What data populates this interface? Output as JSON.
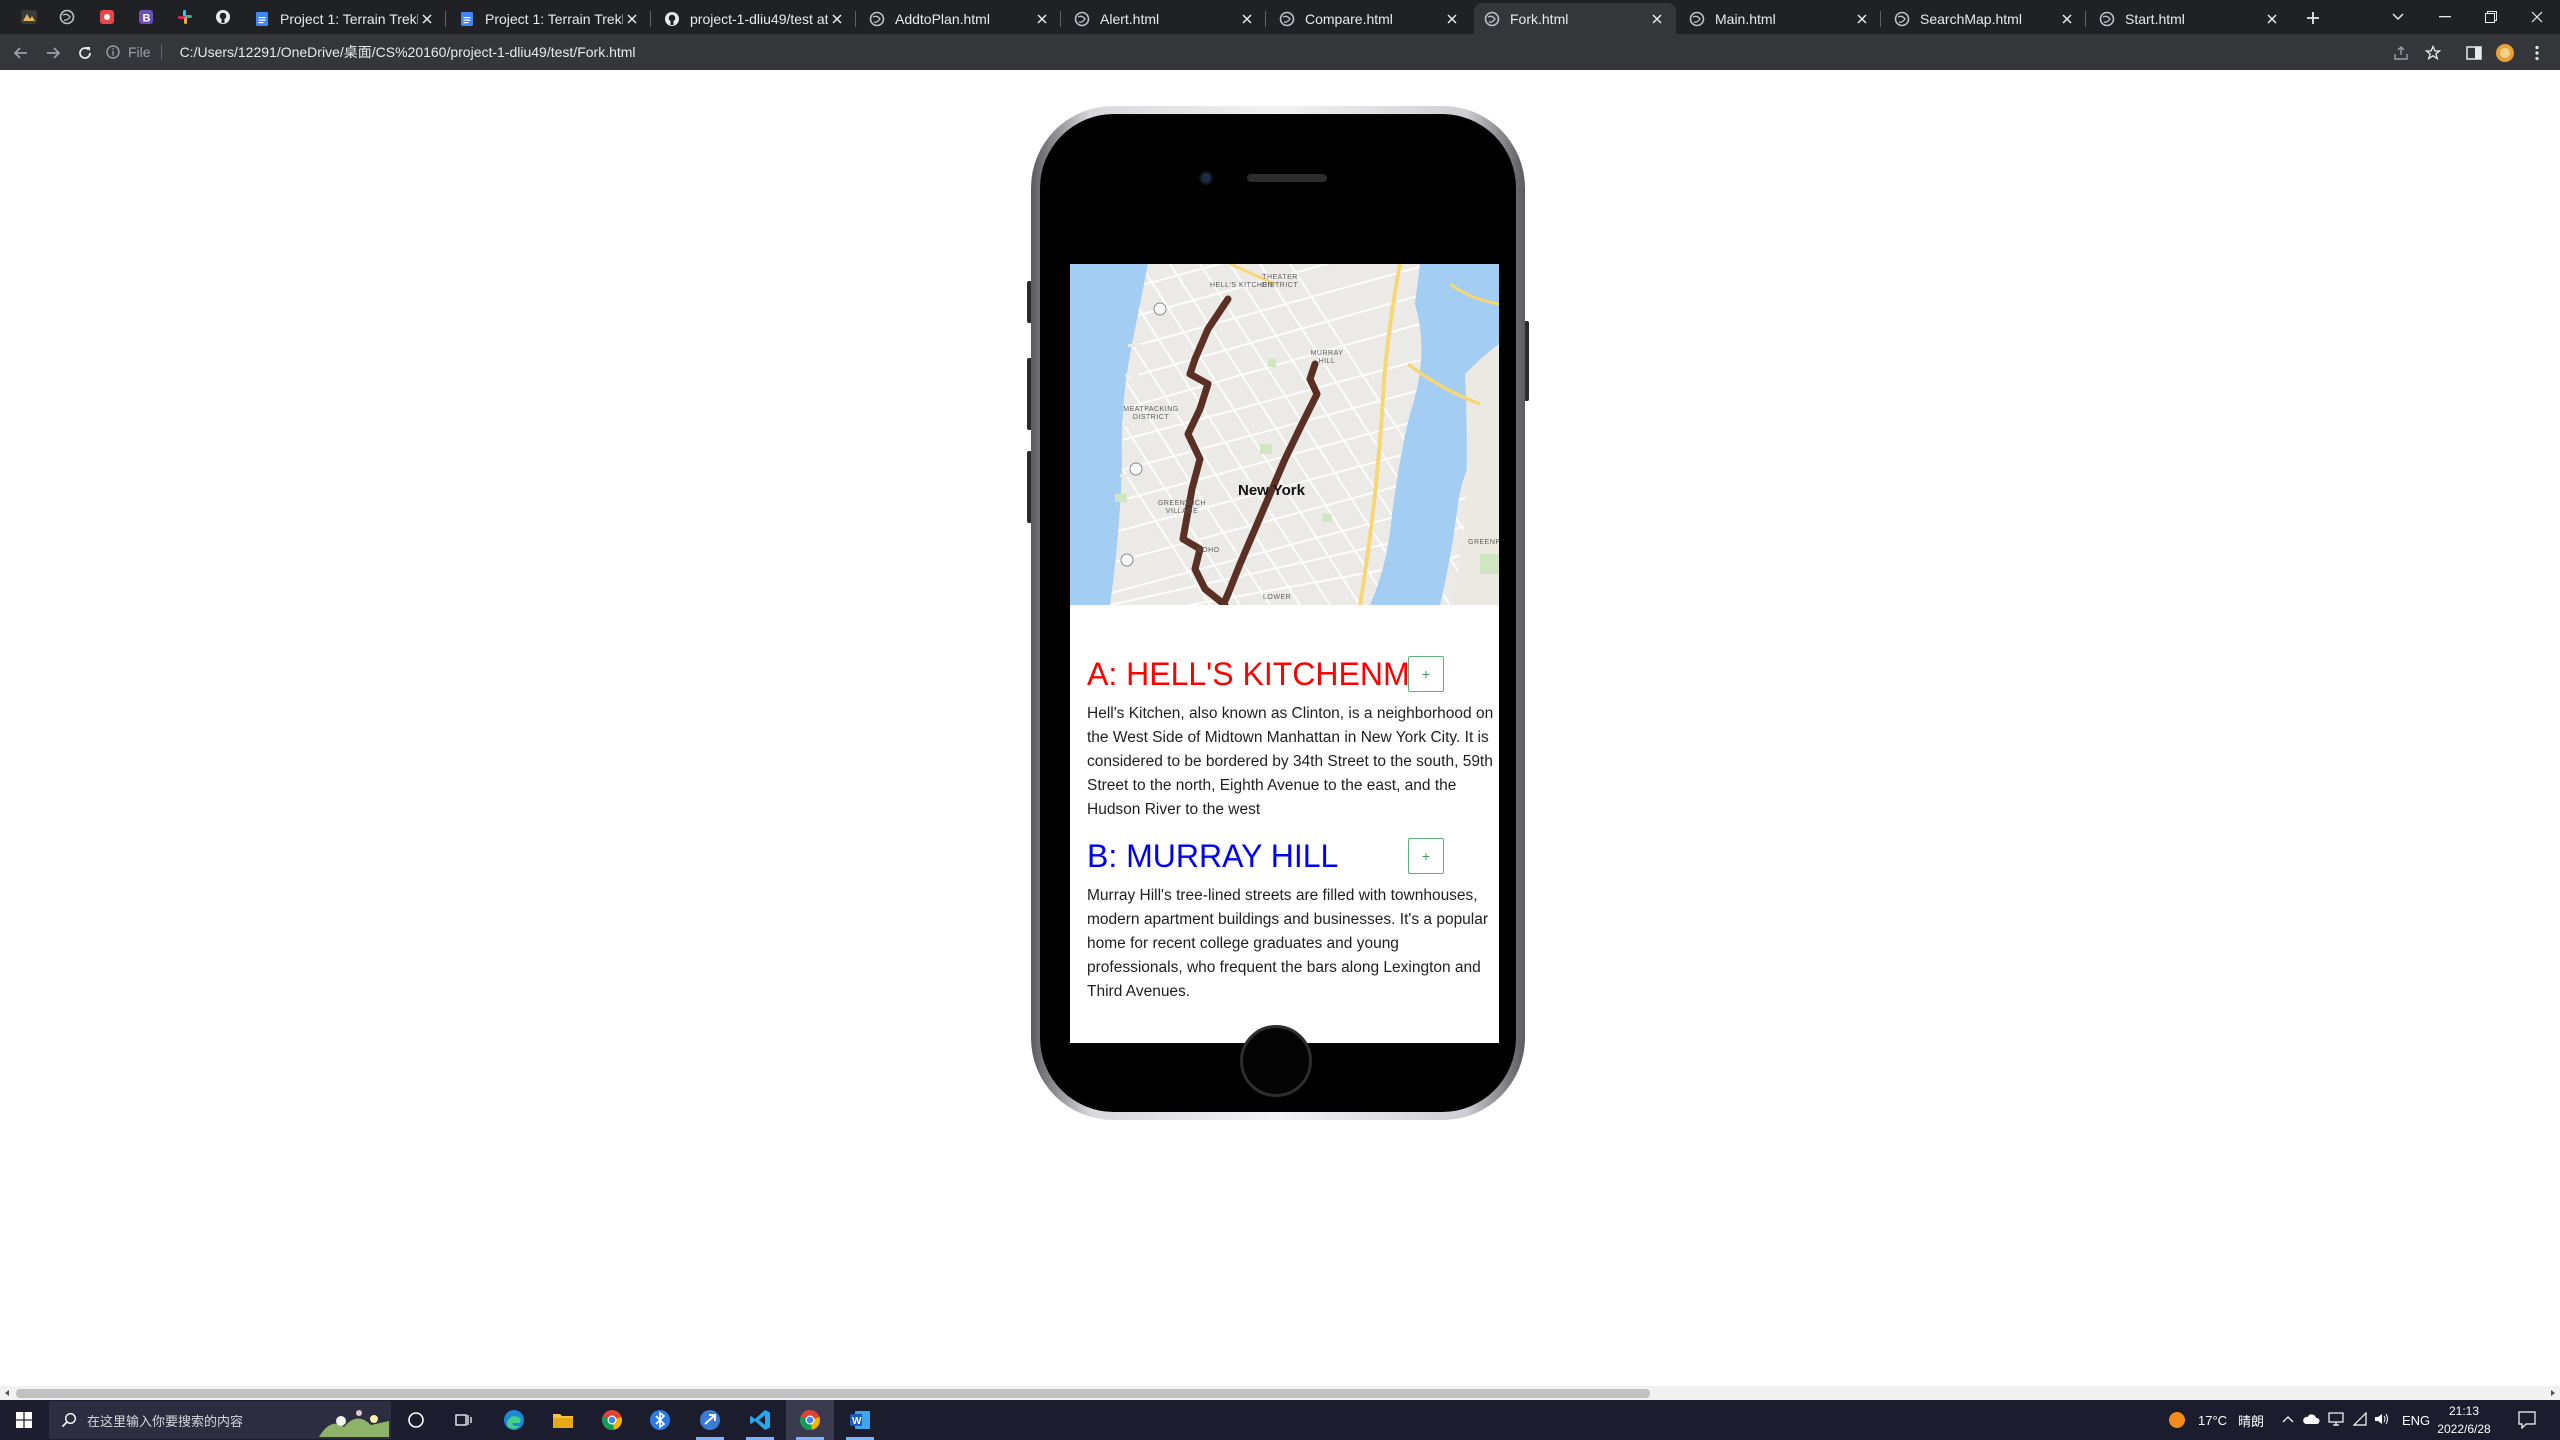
{
  "browser": {
    "tabs": [
      {
        "label": "Project 1: Terrain Trekker",
        "icon": "google-docs-icon",
        "active": false
      },
      {
        "label": "Project 1: Terrain Trekker",
        "icon": "google-docs-icon",
        "active": false
      },
      {
        "label": "project-1-dliu49/test at",
        "icon": "github-icon",
        "active": false
      },
      {
        "label": "AddtoPlan.html",
        "icon": "globe-icon",
        "active": false
      },
      {
        "label": "Alert.html",
        "icon": "globe-icon",
        "active": false
      },
      {
        "label": "Compare.html",
        "icon": "globe-icon",
        "active": false
      },
      {
        "label": "Fork.html",
        "icon": "globe-icon",
        "active": true
      },
      {
        "label": "Main.html",
        "icon": "globe-icon",
        "active": false
      },
      {
        "label": "SearchMap.html",
        "icon": "globe-icon",
        "active": false
      },
      {
        "label": "Start.html",
        "icon": "globe-icon",
        "active": false
      }
    ],
    "pinned_icons": [
      "app-icon",
      "globe-icon",
      "extension-red-icon",
      "b-icon",
      "slack-icon",
      "github-icon"
    ],
    "site_info_label": "File",
    "url": "C:/Users/12291/OneDrive/桌面/CS%20160/project-1-dliu49/test/Fork.html"
  },
  "map": {
    "city_label": "New York",
    "labels": [
      "HELL'S KITCHEN",
      "THEATER DISTRICT",
      "MURRAY HILL",
      "MEATPACKING DISTRICT",
      "GREENWICH VILLAGE",
      "SOHO",
      "LOWER",
      "GREENP"
    ],
    "route_color": "#5a2f24"
  },
  "places": [
    {
      "title": "A: HELL'S KITCHENM",
      "color": "#ff0000",
      "add_label": "+",
      "description": "Hell's Kitchen, also known as Clinton, is a neighborhood on the West Side of Midtown Manhattan in New York City. It is considered to be bordered by 34th Street to the south, 59th Street to the north, Eighth Avenue to the east, and the Hudson River to the west"
    },
    {
      "title": "B: MURRAY HILL",
      "color": "#0000ee",
      "add_label": "+",
      "description": "Murray Hill's tree-lined streets are filled with townhouses, modern apartment buildings and businesses. It's a popular home for recent college graduates and young professionals, who frequent the bars along Lexington and Third Avenues."
    }
  ],
  "taskbar": {
    "search_placeholder": "在这里输入你要搜索的内容",
    "weather": "17°C",
    "weather_desc": "晴朗",
    "language": "ENG",
    "time": "21:13",
    "date": "2022/6/28"
  }
}
